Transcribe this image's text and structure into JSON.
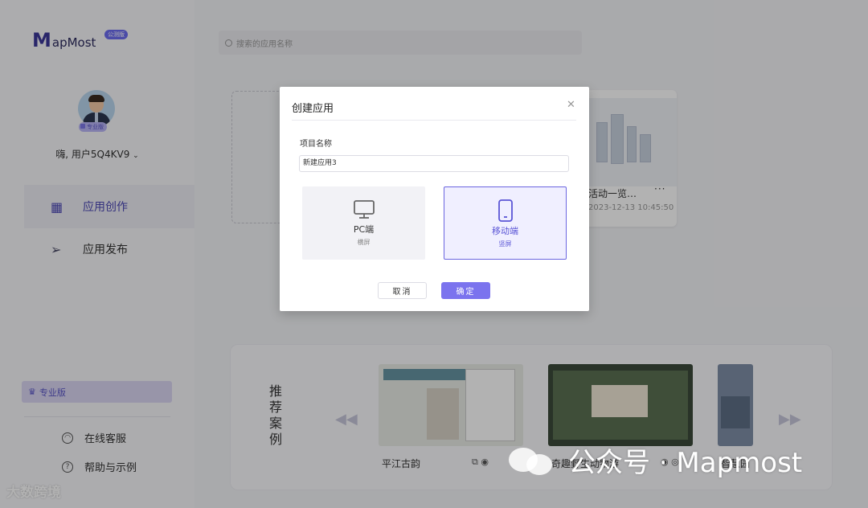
{
  "sidebar": {
    "logo_text": "apMost",
    "logo_initial": "M",
    "beta_badge": "公测版",
    "avatar_badge": "专业版",
    "username": "嗨, 用户5Q4KV9",
    "nav": [
      {
        "label": "应用创作",
        "icon": "app-create-icon",
        "active": true
      },
      {
        "label": "应用发布",
        "icon": "send-icon",
        "active": false
      }
    ],
    "pro_edition": "专业版",
    "links": [
      {
        "label": "在线客服",
        "icon": "headset-icon"
      },
      {
        "label": "帮助与示例",
        "icon": "help-icon"
      }
    ]
  },
  "search": {
    "placeholder": "搜索的应用名称"
  },
  "app_card": {
    "title": "活动一览…",
    "more": "···",
    "date": "2023-12-13 10:45:50"
  },
  "recommend": {
    "title": "推荐案例",
    "items": [
      {
        "name": "平江古韵"
      },
      {
        "name": "奇趣野生动物游"
      },
      {
        "name": "智慧园"
      }
    ]
  },
  "dialog": {
    "title": "创建应用",
    "field_label": "项目名称",
    "field_value": "新建应用3",
    "options": [
      {
        "name": "PC端",
        "sub": "横屏",
        "selected": false
      },
      {
        "name": "移动端",
        "sub": "竖屏",
        "selected": true
      }
    ],
    "cancel": "取消",
    "ok": "确定"
  },
  "watermarks": {
    "left": "大数跨境",
    "right": "公众号 · Mapmost"
  },
  "colors": {
    "accent": "#7b73ee",
    "brand": "#3c3799"
  }
}
